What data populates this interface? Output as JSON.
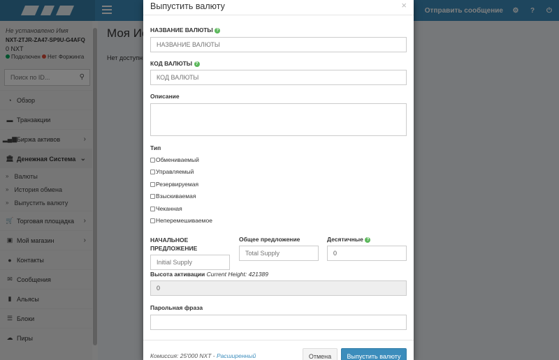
{
  "header": {
    "send_message": "Отправить сообщение"
  },
  "user": {
    "name": "Не установлено Имя",
    "account": "NXT-2TJR-ZA47-SP9U-G4AFQ",
    "balance": "0 NXT",
    "connected": "Подключен",
    "forging": "Нет Форжинга"
  },
  "search": {
    "placeholder": "Поиск по ID..."
  },
  "sidebar": {
    "items": [
      {
        "label": "Обзор"
      },
      {
        "label": "Транзакции"
      },
      {
        "label": "Биржа активов"
      },
      {
        "label": "Денежная Система"
      },
      {
        "label": "Торговая площадка"
      },
      {
        "label": "Мой магазин"
      },
      {
        "label": "Контакты"
      },
      {
        "label": "Сообщения"
      },
      {
        "label": "Альясы"
      },
      {
        "label": "Блоки"
      },
      {
        "label": "Пиры"
      }
    ],
    "subitems": [
      {
        "label": "Валюты"
      },
      {
        "label": "История обмена"
      },
      {
        "label": "Выпустить валюту"
      }
    ]
  },
  "content": {
    "title": "Моя Ис",
    "text": "Нет доступн"
  },
  "modal": {
    "title": "Выпустить валюту",
    "close": "×",
    "currency_name_label": "НАЗВАНИЕ ВАЛЮТЫ",
    "currency_name_placeholder": "НАЗВАНИЕ ВАЛЮТЫ",
    "currency_code_label": "КОД ВАЛЮТЫ",
    "currency_code_placeholder": "КОД ВАЛЮТЫ",
    "description_label": "Описание",
    "type_label": "Тип",
    "types": [
      {
        "label": "Обмениваемый"
      },
      {
        "label": "Управляемый"
      },
      {
        "label": "Резервируемая"
      },
      {
        "label": "Взыскиваемая"
      },
      {
        "label": "Чеканная"
      },
      {
        "label": "Неперемешиваемое"
      }
    ],
    "initial_supply_label_1": "НАЧАЛЬНОЕ",
    "initial_supply_label_2": "ПРЕДЛОЖЕНИЕ",
    "initial_supply_placeholder": "Initial Supply",
    "total_supply_label": "Общее предложение",
    "total_supply_placeholder": "Total Supply",
    "decimals_label": "Десятичные",
    "decimals_value": "0",
    "activation_label": "Высота активации",
    "current_height": "Current Height: 421389",
    "activation_value": "0",
    "passphrase_label": "Парольная фраза",
    "fee_label": "Комиссия:",
    "fee_value": "25'000 NXT",
    "fee_sep": " - ",
    "advanced_link": "Расширенный",
    "cancel_button": "Отмена",
    "submit_button": "Выпустить валюту"
  },
  "colors": {
    "header": "#3c8dbc",
    "logo_bg": "#367fa9",
    "primary": "#3c8dbc",
    "help": "#5cb85c",
    "status_green": "#00a65a",
    "status_red": "#dd4b39"
  }
}
